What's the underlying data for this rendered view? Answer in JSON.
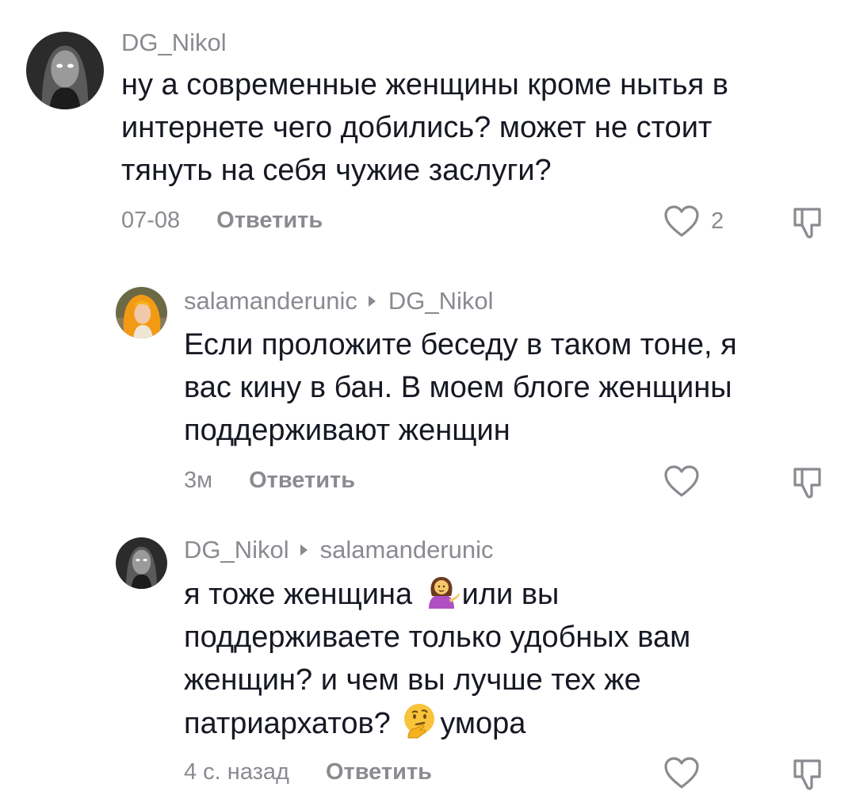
{
  "comments": [
    {
      "username": "DG_Nikol",
      "reply_to": "",
      "text_lines": [
        "ну а современные женщины кроме нытья в",
        "интернете чего добились? может не стоит",
        "тянуть на себя чужие заслуги?"
      ],
      "time": "07-08",
      "reply_label": "Ответить",
      "likes": "2",
      "avatar_icon": "dark-portrait-avatar"
    },
    {
      "username": "salamanderunic",
      "reply_to": "DG_Nikol",
      "text_lines": [
        "Если проложите беседу в таком тоне, я",
        "вас кину в бан. В моем блоге женщины",
        "поддерживают женщин"
      ],
      "time": "3м",
      "reply_label": "Ответить",
      "likes": "",
      "avatar_icon": "orange-hair-avatar"
    },
    {
      "username": "DG_Nikol",
      "reply_to": "salamanderunic",
      "line1_before": "я тоже женщина ",
      "line1_emoji": "woman-tipping-hand-emoji",
      "line1_after": "или вы",
      "line2": "поддерживаете только удобных вам",
      "line3": "женщин? и чем вы лучше тех же",
      "line4_before": "патриархатов? ",
      "line4_emoji": "thinking-face-emoji",
      "line4_after": "умора",
      "time": "4 с. назад",
      "reply_label": "Ответить",
      "likes": "",
      "avatar_icon": "dark-portrait-avatar"
    }
  ],
  "colors": {
    "text": "#161823",
    "secondary": "#8a8b91"
  },
  "icons": [
    "heart-outline-icon",
    "thumbs-down-outline-icon",
    "reply-arrow-icon"
  ]
}
